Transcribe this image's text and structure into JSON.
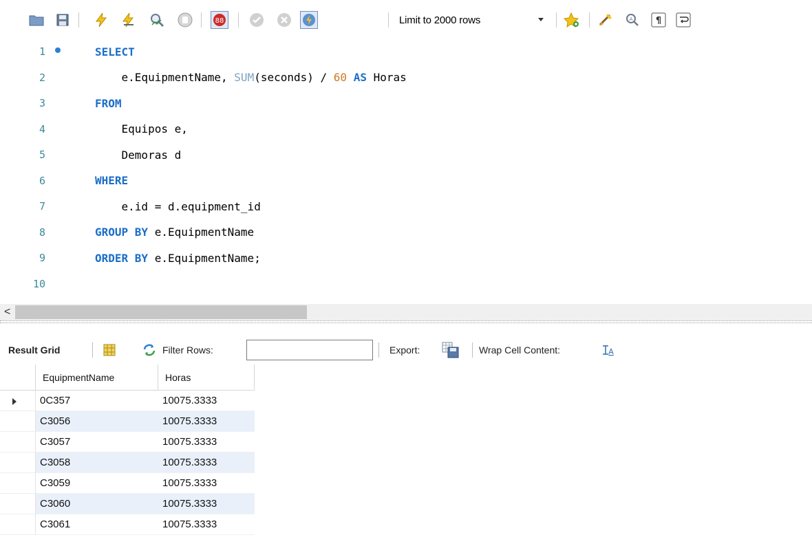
{
  "toolbar": {
    "limit_label": "Limit to 2000 rows",
    "icons": [
      "open-folder-icon",
      "save-icon",
      "execute-icon",
      "execute-current-icon",
      "explain-icon",
      "stop-icon",
      "toggle-continue-on-error-icon",
      "commit-icon",
      "rollback-icon",
      "autocommit-icon",
      "add-snippet-icon",
      "beautify-icon",
      "find-icon",
      "invisible-chars-icon",
      "word-wrap-icon"
    ]
  },
  "editor": {
    "lines": [
      {
        "n": "1",
        "html": "<span class=\"kw\">SELECT</span>"
      },
      {
        "n": "2",
        "html": "    e.EquipmentName, <span class=\"fn\">SUM</span>(seconds) / <span class=\"num\">60</span> <span class=\"kw\">AS</span> Horas"
      },
      {
        "n": "3",
        "html": "<span class=\"kw\">FROM</span>"
      },
      {
        "n": "4",
        "html": "    Equipos e,"
      },
      {
        "n": "5",
        "html": "    Demoras d"
      },
      {
        "n": "6",
        "html": "<span class=\"kw\">WHERE</span>"
      },
      {
        "n": "7",
        "html": "    e.id = d.equipment_id"
      },
      {
        "n": "8",
        "html": "<span class=\"kw\">GROUP BY</span> e.EquipmentName"
      },
      {
        "n": "9",
        "html": "<span class=\"kw\">ORDER BY</span> e.EquipmentName;"
      },
      {
        "n": "10",
        "html": ""
      }
    ],
    "scroll_left_glyph": "<"
  },
  "results": {
    "tab_label": "Result Grid",
    "filter_label": "Filter Rows:",
    "filter_value": "",
    "export_label": "Export:",
    "wrap_label": "Wrap Cell Content:",
    "columns": [
      "EquipmentName",
      "Horas"
    ],
    "rows": [
      [
        "0C357",
        "10075.3333"
      ],
      [
        "C3056",
        "10075.3333"
      ],
      [
        "C3057",
        "10075.3333"
      ],
      [
        "C3058",
        "10075.3333"
      ],
      [
        "C3059",
        "10075.3333"
      ],
      [
        "C3060",
        "10075.3333"
      ],
      [
        "C3061",
        "10075.3333"
      ]
    ],
    "colors": {
      "alt_row": "#e9f0fa",
      "keyword": "#1a6ec8",
      "number": "#d07820",
      "function": "#7ea3c0",
      "line_number": "#3c8a9a"
    }
  }
}
